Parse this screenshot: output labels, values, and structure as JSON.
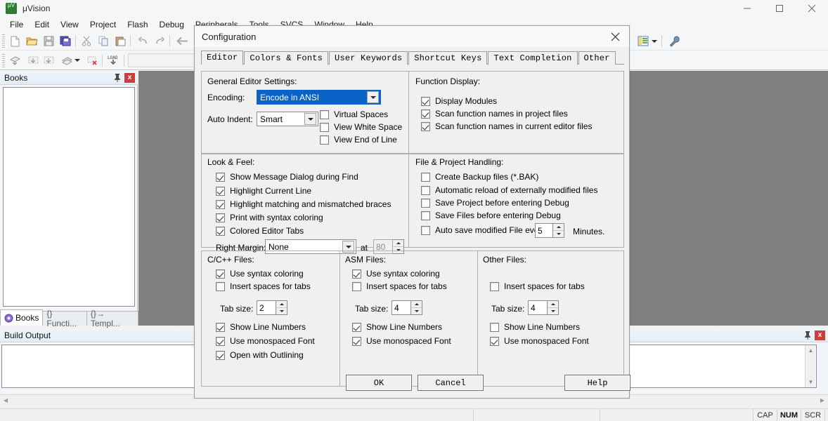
{
  "window": {
    "app_title": "μVision",
    "app_icon": "uvision-logo-icon",
    "minimize": "–",
    "maximize": "□",
    "close": "✕"
  },
  "menubar": {
    "items": [
      {
        "label": "File"
      },
      {
        "label": "Edit"
      },
      {
        "label": "View"
      },
      {
        "label": "Project"
      },
      {
        "label": "Flash"
      },
      {
        "label": "Debug"
      },
      {
        "label": "Peripherals"
      },
      {
        "label": "Tools"
      },
      {
        "label": "SVCS"
      },
      {
        "label": "Window"
      },
      {
        "label": "Help"
      }
    ]
  },
  "books_panel": {
    "title": "Books",
    "pin": "pin-icon",
    "close": "x",
    "tabs": [
      {
        "label": "Books",
        "active": true
      },
      {
        "label": "{} Functi...",
        "active": false
      },
      {
        "label": "{}→ Templ...",
        "active": false
      }
    ]
  },
  "build_panel": {
    "title": "Build Output"
  },
  "statusbar": {
    "indicators": [
      {
        "label": "CAP",
        "active": false
      },
      {
        "label": "NUM",
        "active": true
      },
      {
        "label": "SCR",
        "active": false
      }
    ]
  },
  "dialog": {
    "title": "Configuration",
    "close_label": "✕",
    "tabs": [
      {
        "label": "Editor",
        "active": true
      },
      {
        "label": "Colors & Fonts",
        "active": false
      },
      {
        "label": "User Keywords",
        "active": false
      },
      {
        "label": "Shortcut Keys",
        "active": false
      },
      {
        "label": "Text Completion",
        "active": false
      },
      {
        "label": "Other",
        "active": false
      }
    ],
    "general_editor_settings": {
      "title": "General Editor Settings:",
      "encoding_label": "Encoding:",
      "encoding_value": "Encode in ANSI",
      "encoding_selected": true,
      "auto_indent_label": "Auto Indent:",
      "auto_indent_value": "Smart",
      "checkboxes": [
        {
          "label": "Virtual Spaces",
          "checked": false
        },
        {
          "label": "View White Space",
          "checked": false
        },
        {
          "label": "View End of Line",
          "checked": false
        }
      ]
    },
    "function_display": {
      "title": "Function Display:",
      "checkboxes": [
        {
          "label": "Display Modules",
          "checked": true
        },
        {
          "label": "Scan function names in project files",
          "checked": true
        },
        {
          "label": "Scan function names in current editor files",
          "checked": true
        }
      ]
    },
    "look_and_feel": {
      "title": "Look & Feel:",
      "checkboxes": [
        {
          "label": "Show Message Dialog during Find",
          "checked": true
        },
        {
          "label": "Highlight Current Line",
          "checked": true
        },
        {
          "label": "Highlight matching and mismatched braces",
          "checked": true
        },
        {
          "label": "Print with syntax coloring",
          "checked": true
        },
        {
          "label": "Colored Editor Tabs",
          "checked": true
        }
      ],
      "right_margin_label": "Right Margin:",
      "right_margin_value": "None",
      "at_label": "at",
      "at_value": "80",
      "at_disabled": true
    },
    "file_project_handling": {
      "title": "File & Project Handling:",
      "checkboxes": [
        {
          "label": "Create Backup files (*.BAK)",
          "checked": false
        },
        {
          "label": "Automatic reload of externally modified files",
          "checked": false
        },
        {
          "label": "Save Project before entering Debug",
          "checked": false
        },
        {
          "label": "Save Files before entering Debug",
          "checked": false
        },
        {
          "label": "Auto save modified File every",
          "checked": false
        }
      ],
      "autosave_value": "5",
      "minutes_label": "Minutes."
    },
    "c_cpp_files": {
      "title": "C/C++ Files:",
      "use_syntax_coloring": {
        "label": "Use syntax coloring",
        "checked": true
      },
      "insert_spaces": {
        "label": "Insert spaces for tabs",
        "checked": false
      },
      "tab_size_label": "Tab size:",
      "tab_size_value": "2",
      "show_line_numbers": {
        "label": "Show Line Numbers",
        "checked": true
      },
      "use_monospaced": {
        "label": "Use monospaced Font",
        "checked": true
      },
      "open_with_outlining": {
        "label": "Open with Outlining",
        "checked": true
      }
    },
    "asm_files": {
      "title": "ASM Files:",
      "use_syntax_coloring": {
        "label": "Use syntax coloring",
        "checked": true
      },
      "insert_spaces": {
        "label": "Insert spaces for tabs",
        "checked": false
      },
      "tab_size_label": "Tab size:",
      "tab_size_value": "4",
      "show_line_numbers": {
        "label": "Show Line Numbers",
        "checked": true
      },
      "use_monospaced": {
        "label": "Use monospaced Font",
        "checked": true
      }
    },
    "other_files": {
      "title": "Other Files:",
      "insert_spaces": {
        "label": "Insert spaces for tabs",
        "checked": false
      },
      "tab_size_label": "Tab size:",
      "tab_size_value": "4",
      "show_line_numbers": {
        "label": "Show Line Numbers",
        "checked": false
      },
      "use_monospaced": {
        "label": "Use monospaced Font",
        "checked": true
      }
    },
    "buttons": {
      "ok": "OK",
      "cancel": "Cancel",
      "help": "Help"
    }
  },
  "colors": {
    "dialog_bg": "#f0f0f0",
    "selection_blue": "#0a64c8",
    "panel_header": "#e4edf6",
    "close_red": "#cc3d3d",
    "mdi_gray": "#7f7f7f"
  }
}
